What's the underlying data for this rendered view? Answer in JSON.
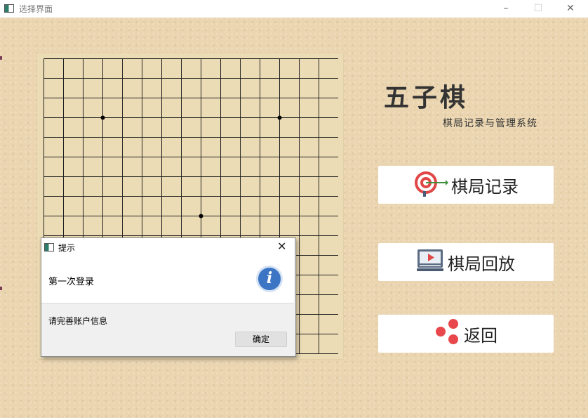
{
  "window": {
    "title": "选择界面",
    "controls": {
      "minimize": "–",
      "maximize": "☐",
      "close": "✕"
    }
  },
  "heading": {
    "title": "五子棋",
    "subtitle": "棋局记录与管理系统"
  },
  "menu": [
    {
      "label": "棋局记录",
      "icon": "target-icon"
    },
    {
      "label": "棋局回放",
      "icon": "video-player-icon"
    },
    {
      "label": "返回",
      "icon": "red-dots-icon"
    }
  ],
  "board": {
    "lines": 16,
    "star_points": [
      [
        3,
        3
      ],
      [
        12,
        3
      ],
      [
        8,
        8
      ]
    ]
  },
  "dialog": {
    "title": "提示",
    "close_glyph": "✕",
    "message": "第一次登录",
    "detail": "请完善账户信息",
    "ok_label": "确定",
    "info_glyph": "i"
  },
  "colors": {
    "background": "#ead5b0",
    "board": "#ecdcb5",
    "info_blue": "#3b75c4",
    "dot_red": "#e8474b"
  }
}
